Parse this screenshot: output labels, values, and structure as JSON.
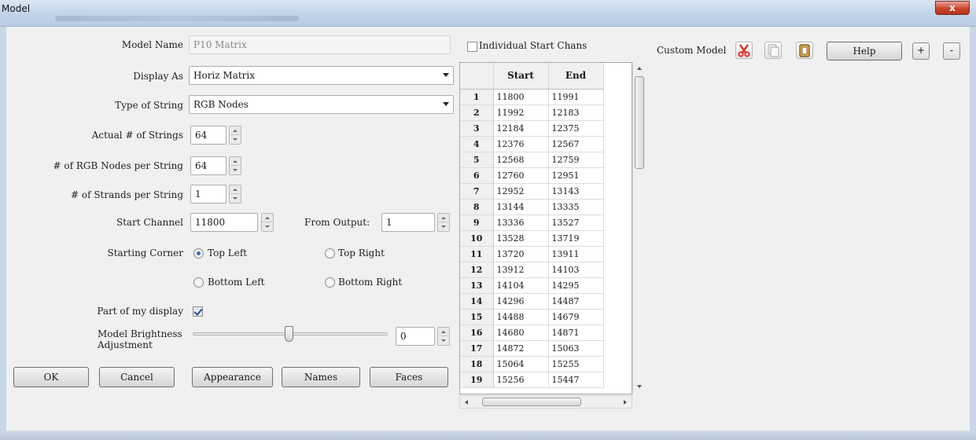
{
  "window": {
    "title": "Model",
    "close_label": "x"
  },
  "form": {
    "model_name_label": "Model Name",
    "model_name_value": "P10 Matrix",
    "display_as_label": "Display As",
    "display_as_value": "Horiz Matrix",
    "string_type_label": "Type of String",
    "string_type_value": "RGB Nodes",
    "strings_label": "Actual # of Strings",
    "strings_value": "64",
    "nodes_label": "# of RGB Nodes per String",
    "nodes_value": "64",
    "strands_label": "# of Strands per String",
    "strands_value": "1",
    "start_channel_label": "Start Channel",
    "start_channel_value": "11800",
    "from_output_label": "From Output:",
    "from_output_value": "1",
    "starting_corner_label": "Starting Corner",
    "corner_top_left": "Top Left",
    "corner_top_right": "Top Right",
    "corner_bottom_left": "Bottom Left",
    "corner_bottom_right": "Bottom Right",
    "selected_corner": "Top Left",
    "part_of_display_label": "Part of my display",
    "part_of_display_checked": true,
    "brightness_label_1": "Model Brightness",
    "brightness_label_2": "Adjustment",
    "brightness_value": "0"
  },
  "buttons": {
    "ok": "OK",
    "cancel": "Cancel",
    "appearance": "Appearance",
    "names": "Names",
    "faces": "Faces"
  },
  "channels": {
    "individual_start_label": "Individual Start Chans",
    "individual_start_checked": false,
    "columns": [
      "Start",
      "End"
    ],
    "rows": [
      [
        "1",
        "11800",
        "11991"
      ],
      [
        "2",
        "11992",
        "12183"
      ],
      [
        "3",
        "12184",
        "12375"
      ],
      [
        "4",
        "12376",
        "12567"
      ],
      [
        "5",
        "12568",
        "12759"
      ],
      [
        "6",
        "12760",
        "12951"
      ],
      [
        "7",
        "12952",
        "13143"
      ],
      [
        "8",
        "13144",
        "13335"
      ],
      [
        "9",
        "13336",
        "13527"
      ],
      [
        "10",
        "13528",
        "13719"
      ],
      [
        "11",
        "13720",
        "13911"
      ],
      [
        "12",
        "13912",
        "14103"
      ],
      [
        "13",
        "14104",
        "14295"
      ],
      [
        "14",
        "14296",
        "14487"
      ],
      [
        "15",
        "14488",
        "14679"
      ],
      [
        "16",
        "14680",
        "14871"
      ],
      [
        "17",
        "14872",
        "15063"
      ],
      [
        "18",
        "15064",
        "15255"
      ],
      [
        "19",
        "15256",
        "15447"
      ]
    ]
  },
  "custom_model": {
    "label": "Custom Model",
    "help_label": "Help",
    "plus_label": "+",
    "minus_label": "-",
    "icons": [
      "cut-icon",
      "copy-icon",
      "paste-icon"
    ]
  },
  "colors": {
    "accent": "#2b6fc9",
    "close": "#c9452f",
    "cut_icon": "#d6342a",
    "paste_icon": "#c7902b"
  }
}
